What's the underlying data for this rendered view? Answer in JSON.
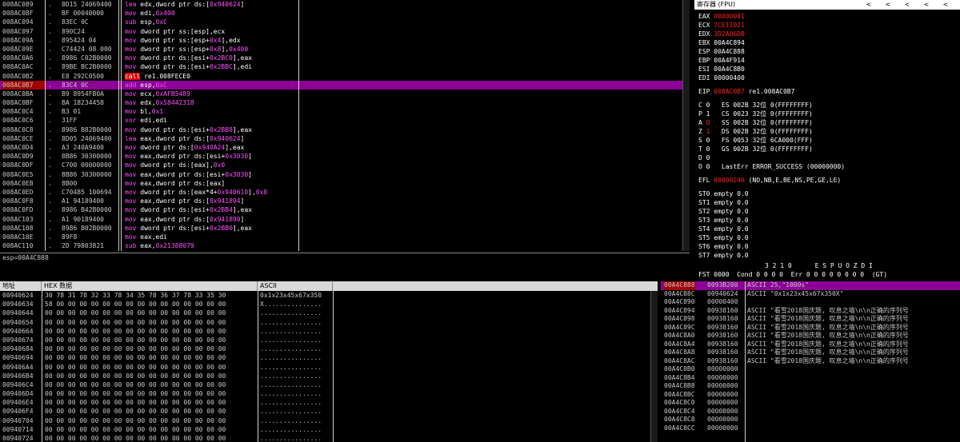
{
  "disasm": {
    "rows": [
      {
        "addr": "008AC089",
        "mark": ".",
        "hex": "8D15 24069400",
        "mn": "lea",
        "ops": [
          [
            "op",
            "edx,dword ptr ds:["
          ],
          [
            "imm",
            "0x940624"
          ],
          [
            "op",
            "]"
          ]
        ]
      },
      {
        "addr": "008AC08F",
        "mark": ".",
        "hex": "BF 00040000",
        "mn": "mov",
        "ops": [
          [
            "op",
            "edi,"
          ],
          [
            "imm",
            "0x400"
          ]
        ]
      },
      {
        "addr": "008AC094",
        "mark": ".",
        "hex": "83EC 0C",
        "mn": "sub",
        "ops": [
          [
            "op",
            "esp,"
          ],
          [
            "imm",
            "0xC"
          ]
        ]
      },
      {
        "addr": "008AC097",
        "mark": ".",
        "hex": "890C24",
        "mn": "mov",
        "ops": [
          [
            "op",
            "dword ptr ss:[esp],ecx"
          ]
        ]
      },
      {
        "addr": "008AC09A",
        "mark": ".",
        "hex": "895424 04",
        "mn": "mov",
        "ops": [
          [
            "op",
            "dword ptr ss:[esp+"
          ],
          [
            "imm",
            "0x4"
          ],
          [
            "op",
            "],edx"
          ]
        ]
      },
      {
        "addr": "008AC09E",
        "mark": ".",
        "hex": "C74424 08 000",
        "mn": "mov",
        "ops": [
          [
            "op",
            "dword ptr ss:[esp+"
          ],
          [
            "imm",
            "0x8"
          ],
          [
            "op",
            "],"
          ],
          [
            "imm",
            "0x400"
          ]
        ]
      },
      {
        "addr": "008AC0A6",
        "mark": ".",
        "hex": "8986 C02B0000",
        "mn": "mov",
        "ops": [
          [
            "op",
            "dword ptr ds:[esi+"
          ],
          [
            "imm",
            "0x2BC0"
          ],
          [
            "op",
            "],eax"
          ]
        ]
      },
      {
        "addr": "008AC0AC",
        "mark": ".",
        "hex": "89BE BC2B0000",
        "mn": "mov",
        "ops": [
          [
            "op",
            "dword ptr ds:[esi+"
          ],
          [
            "imm",
            "0x2BBC"
          ],
          [
            "op",
            "],edi"
          ]
        ]
      },
      {
        "addr": "008AC0B2",
        "mark": ".",
        "hex": "E8 292C0500",
        "mn": "call",
        "ops": [
          [
            "op",
            "re1.008FECE0"
          ]
        ],
        "call": true
      },
      {
        "addr": "008AC0B7",
        "mark": ".",
        "hex": "83C4 0C",
        "mn": "add",
        "ops": [
          [
            "op",
            "esp,"
          ],
          [
            "imm",
            "0xC"
          ]
        ],
        "current": true
      },
      {
        "addr": "008AC0BA",
        "mark": ".",
        "hex": "B9 8954FB0A",
        "mn": "mov",
        "ops": [
          [
            "op",
            "ecx,"
          ],
          [
            "imm",
            "0xAFB5489"
          ]
        ]
      },
      {
        "addr": "008AC0BF",
        "mark": ".",
        "hex": "BA 18234458",
        "mn": "mov",
        "ops": [
          [
            "op",
            "edx,"
          ],
          [
            "imm",
            "0x58442318"
          ]
        ]
      },
      {
        "addr": "008AC0C4",
        "mark": ".",
        "hex": "B3 01",
        "mn": "mov",
        "ops": [
          [
            "op",
            "bl,"
          ],
          [
            "imm",
            "0x1"
          ]
        ]
      },
      {
        "addr": "008AC0C6",
        "mark": ".",
        "hex": "31FF",
        "mn": "xor",
        "ops": [
          [
            "op",
            "edi,edi"
          ]
        ]
      },
      {
        "addr": "008AC0C8",
        "mark": ".",
        "hex": "8986 B82B0000",
        "mn": "mov",
        "ops": [
          [
            "op",
            "dword ptr ds:[esi+"
          ],
          [
            "imm",
            "0x2BB8"
          ],
          [
            "op",
            "],eax"
          ]
        ]
      },
      {
        "addr": "008AC0CE",
        "mark": ".",
        "hex": "8D05 24069400",
        "mn": "lea",
        "ops": [
          [
            "op",
            "eax,dword ptr ds:["
          ],
          [
            "imm",
            "0x940624"
          ],
          [
            "op",
            "]"
          ]
        ]
      },
      {
        "addr": "008AC0D4",
        "mark": ".",
        "hex": "A3 240A9400",
        "mn": "mov",
        "ops": [
          [
            "op",
            "dword ptr ds:["
          ],
          [
            "imm",
            "0x940A24"
          ],
          [
            "op",
            "],eax"
          ]
        ]
      },
      {
        "addr": "008AC0D9",
        "mark": ".",
        "hex": "8B86 30300000",
        "mn": "mov",
        "ops": [
          [
            "op",
            "eax,dword ptr ds:[esi+"
          ],
          [
            "imm",
            "0x3030"
          ],
          [
            "op",
            "]"
          ]
        ]
      },
      {
        "addr": "008AC0DF",
        "mark": ".",
        "hex": "C700 00000000",
        "mn": "mov",
        "ops": [
          [
            "op",
            "dword ptr ds:[eax],"
          ],
          [
            "imm",
            "0x0"
          ]
        ]
      },
      {
        "addr": "008AC0E5",
        "mark": ".",
        "hex": "8B86 30300000",
        "mn": "mov",
        "ops": [
          [
            "op",
            "eax,dword ptr ds:[esi+"
          ],
          [
            "imm",
            "0x3030"
          ],
          [
            "op",
            "]"
          ]
        ]
      },
      {
        "addr": "008AC0EB",
        "mark": ".",
        "hex": "8B00",
        "mn": "mov",
        "ops": [
          [
            "op",
            "eax,dword ptr ds:[eax]"
          ]
        ]
      },
      {
        "addr": "008AC0ED",
        "mark": ".",
        "hex": "C70485 100694",
        "mn": "mov",
        "ops": [
          [
            "op",
            "dword ptr ds:[eax*4+"
          ],
          [
            "imm",
            "0x940610"
          ],
          [
            "op",
            "],"
          ],
          [
            "imm",
            "0x0"
          ]
        ]
      },
      {
        "addr": "008AC0F8",
        "mark": ".",
        "hex": "A1 94189400",
        "mn": "mov",
        "ops": [
          [
            "op",
            "eax,dword ptr ds:["
          ],
          [
            "imm",
            "0x941894"
          ],
          [
            "op",
            "]"
          ]
        ]
      },
      {
        "addr": "008AC0FD",
        "mark": ".",
        "hex": "8986 B42B0000",
        "mn": "mov",
        "ops": [
          [
            "op",
            "dword ptr ds:[esi+"
          ],
          [
            "imm",
            "0x2BB4"
          ],
          [
            "op",
            "],eax"
          ]
        ]
      },
      {
        "addr": "008AC103",
        "mark": ".",
        "hex": "A1 90189400",
        "mn": "mov",
        "ops": [
          [
            "op",
            "eax,dword ptr ds:["
          ],
          [
            "imm",
            "0x941890"
          ],
          [
            "op",
            "]"
          ]
        ]
      },
      {
        "addr": "008AC108",
        "mark": ".",
        "hex": "8986 B02B0000",
        "mn": "mov",
        "ops": [
          [
            "op",
            "dword ptr ds:[esi+"
          ],
          [
            "imm",
            "0x2BB0"
          ],
          [
            "op",
            "],eax"
          ]
        ]
      },
      {
        "addr": "008AC10E",
        "mark": ".",
        "hex": "89F8",
        "mn": "mov",
        "ops": [
          [
            "op",
            "eax,edi"
          ]
        ]
      },
      {
        "addr": "008AC110",
        "mark": ".",
        "hex": "2D 79803821",
        "mn": "sub",
        "ops": [
          [
            "op",
            "eax,"
          ],
          [
            "imm",
            "0x21388079"
          ]
        ]
      }
    ]
  },
  "info": {
    "text": "esp=00A4C888"
  },
  "registers": {
    "title": "寄存器 (FPU)",
    "arrows": [
      "<",
      "<",
      "<",
      "<",
      "<"
    ],
    "gpr": [
      {
        "name": "EAX",
        "val": "00000001",
        "changed": true,
        "extra": ""
      },
      {
        "name": "ECX",
        "val": "7CE11021",
        "changed": true,
        "extra": ""
      },
      {
        "name": "EDX",
        "val": "3D2A06DB",
        "changed": true,
        "extra": ""
      },
      {
        "name": "EBX",
        "val": "00A4C894",
        "changed": false,
        "extra": ""
      },
      {
        "name": "ESP",
        "val": "00A4C888",
        "changed": false,
        "extra": ""
      },
      {
        "name": "EBP",
        "val": "00A4F914",
        "changed": false,
        "extra": ""
      },
      {
        "name": "ESI",
        "val": "00A4C8B0",
        "changed": false,
        "extra": ""
      },
      {
        "name": "EDI",
        "val": "00000400",
        "changed": false,
        "extra": ""
      }
    ],
    "eip": {
      "name": "EIP",
      "val": "008AC0B7",
      "extra": "re1.008AC0B7"
    },
    "flags": [
      {
        "f": "C",
        "v": "0",
        "red": false,
        "seg": "ES 002B 32位 0(FFFFFFFF)"
      },
      {
        "f": "P",
        "v": "1",
        "red": false,
        "seg": "CS 0023 32位 0(FFFFFFFF)"
      },
      {
        "f": "A",
        "v": "0",
        "red": true,
        "seg": "SS 002B 32位 0(FFFFFFFF)"
      },
      {
        "f": "Z",
        "v": "1",
        "red": true,
        "seg": "DS 002B 32位 0(FFFFFFFF)"
      },
      {
        "f": "S",
        "v": "0",
        "red": false,
        "seg": "FS 0053 32位 6CA000(FFF)"
      },
      {
        "f": "T",
        "v": "0",
        "red": false,
        "seg": "GS 002B 32位 0(FFFFFFFF)"
      },
      {
        "f": "D",
        "v": "0",
        "red": false,
        "seg": ""
      },
      {
        "f": "O",
        "v": "0",
        "red": false,
        "seg": "LastErr ERROR_SUCCESS (00000000)"
      }
    ],
    "efl": {
      "name": "EFL",
      "val": "00000246",
      "extra": "(NO,NB,E,BE,NS,PE,GE,LE)"
    },
    "st": [
      "ST0 empty 0.0",
      "ST1 empty 0.0",
      "ST2 empty 0.0",
      "ST3 empty 0.0",
      "ST4 empty 0.0",
      "ST5 empty 0.0",
      "ST6 empty 0.0",
      "ST7 empty 0.0"
    ],
    "fpu_hdr": "3 2 1 0      E S P U O Z D I",
    "fst": "FST 0000  Cond 0 0 0 0  Err 0 0 0 0 0 0 0 0  (GT)"
  },
  "dump": {
    "headers": {
      "addr": "地址",
      "hex": "HEX 数据",
      "ascii": "ASCII"
    },
    "rows": [
      {
        "addr": "00940624",
        "hex": "30 78 31 78 32 33 78 34 35 78 36 37 78 33 35 30",
        "asc": "0x1x23x45x67x350"
      },
      {
        "addr": "00940634",
        "hex": "58 00 00 00 00 00 00 00 00 00 00 00 00 00 00 00",
        "asc": "X..............."
      },
      {
        "addr": "00940644",
        "hex": "00 00 00 00 00 00 00 00 00 00 00 00 00 00 00 00",
        "asc": "................"
      },
      {
        "addr": "00940654",
        "hex": "00 00 00 00 00 00 00 00 00 00 00 00 00 00 00 00",
        "asc": "................"
      },
      {
        "addr": "00940664",
        "hex": "00 00 00 00 00 00 00 00 00 00 00 00 00 00 00 00",
        "asc": "................"
      },
      {
        "addr": "00940674",
        "hex": "00 00 00 00 00 00 00 00 00 00 00 00 00 00 00 00",
        "asc": "................"
      },
      {
        "addr": "00940684",
        "hex": "00 00 00 00 00 00 00 00 00 00 00 00 00 00 00 00",
        "asc": "................"
      },
      {
        "addr": "00940694",
        "hex": "00 00 00 00 00 00 00 00 00 00 00 00 00 00 00 00",
        "asc": "................"
      },
      {
        "addr": "009406A4",
        "hex": "00 00 00 00 00 00 00 00 00 00 00 00 00 00 00 00",
        "asc": "................"
      },
      {
        "addr": "009406B4",
        "hex": "00 00 00 00 00 00 00 00 00 00 00 00 00 00 00 00",
        "asc": "................"
      },
      {
        "addr": "009406C4",
        "hex": "00 00 00 00 00 00 00 00 00 00 00 00 00 00 00 00",
        "asc": "................"
      },
      {
        "addr": "009406D4",
        "hex": "00 00 00 00 00 00 00 00 00 00 00 00 00 00 00 00",
        "asc": "................"
      },
      {
        "addr": "009406E4",
        "hex": "00 00 00 00 00 00 00 00 00 00 00 00 00 00 00 00",
        "asc": "................"
      },
      {
        "addr": "009406F4",
        "hex": "00 00 00 00 00 00 00 00 00 00 00 00 00 00 00 00",
        "asc": "................"
      },
      {
        "addr": "00940704",
        "hex": "00 00 00 00 00 00 00 00 00 00 00 00 00 00 00 00",
        "asc": "................"
      },
      {
        "addr": "00940714",
        "hex": "00 00 00 00 00 00 00 00 00 00 00 00 00 00 00 00",
        "asc": "................"
      },
      {
        "addr": "00940724",
        "hex": "00 00 00 00 00 00 00 00 00 00 00 00 00 00 00 00",
        "asc": "................"
      }
    ]
  },
  "stack": {
    "rows": [
      {
        "addr": "00A4C888",
        "val": "0093B200",
        "cm": "ASCII 25,\"1000s\"",
        "hl": true
      },
      {
        "addr": "00A4C88C",
        "val": "00940624",
        "cm": "ASCII \"0x1x23x45x67x350X\""
      },
      {
        "addr": "00A4C890",
        "val": "00000400",
        "cm": ""
      },
      {
        "addr": "00A4C894",
        "val": "00938160",
        "cm": "ASCII \"看雪2018国庆题, 叹息之墙\\n\\n正确的序列号"
      },
      {
        "addr": "00A4C898",
        "val": "00938160",
        "cm": "ASCII \"看雪2018国庆题, 叹息之墙\\n\\n正确的序列号"
      },
      {
        "addr": "00A4C89C",
        "val": "00938160",
        "cm": "ASCII \"看雪2018国庆题, 叹息之墙\\n\\n正确的序列号"
      },
      {
        "addr": "00A4C8A0",
        "val": "00938160",
        "cm": "ASCII \"看雪2018国庆题, 叹息之墙\\n\\n正确的序列号"
      },
      {
        "addr": "00A4C8A4",
        "val": "00938160",
        "cm": "ASCII \"看雪2018国庆题, 叹息之墙\\n\\n正确的序列号"
      },
      {
        "addr": "00A4C8A8",
        "val": "00938160",
        "cm": "ASCII \"看雪2018国庆题, 叹息之墙\\n\\n正确的序列号"
      },
      {
        "addr": "00A4C8AC",
        "val": "00938160",
        "cm": "ASCII \"看雪2018国庆题, 叹息之墙\\n\\n正确的序列号"
      },
      {
        "addr": "00A4C8B0",
        "val": "00000000",
        "cm": ""
      },
      {
        "addr": "00A4C8B4",
        "val": "00000000",
        "cm": ""
      },
      {
        "addr": "00A4C8B8",
        "val": "00000000",
        "cm": ""
      },
      {
        "addr": "00A4C8BC",
        "val": "00000000",
        "cm": ""
      },
      {
        "addr": "00A4C8C0",
        "val": "00000000",
        "cm": ""
      },
      {
        "addr": "00A4C8C4",
        "val": "00000000",
        "cm": ""
      },
      {
        "addr": "00A4C8C8",
        "val": "00000000",
        "cm": ""
      },
      {
        "addr": "00A4C8CC",
        "val": "00000000",
        "cm": ""
      }
    ]
  },
  "colors": {
    "highlight": "#8c0096",
    "current_addr": "#a00000",
    "mnemonic": "#ff50ff",
    "immediate": "#ff50ff",
    "call_bg": "#e00000",
    "changed_reg": "#ff2020",
    "background": "#000000"
  }
}
